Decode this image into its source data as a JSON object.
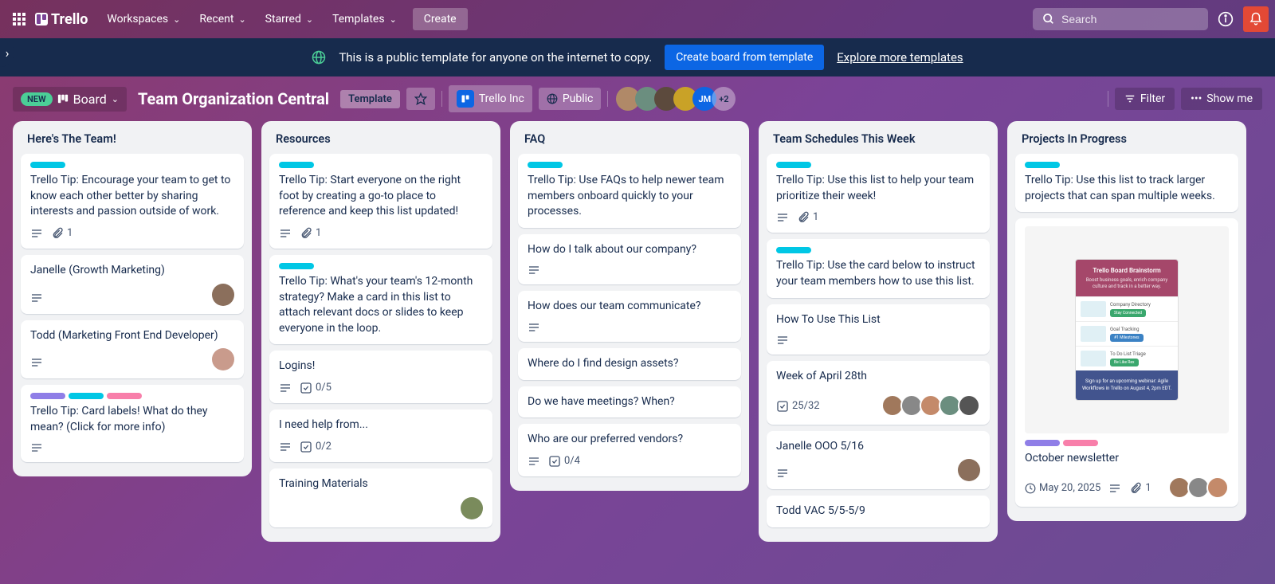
{
  "topnav": {
    "logo": "Trello",
    "menus": [
      "Workspaces",
      "Recent",
      "Starred",
      "Templates"
    ],
    "create": "Create",
    "search_placeholder": "Search"
  },
  "banner": {
    "text": "This is a public template for anyone on the internet to copy.",
    "primary_button": "Create board from template",
    "link": "Explore more templates"
  },
  "board_header": {
    "new_badge": "NEW",
    "view": "Board",
    "title": "Team Organization Central",
    "template_badge": "Template",
    "workspace": "Trello Inc",
    "visibility": "Public",
    "member_overflow": "+2",
    "filter": "Filter",
    "show_menu": "Show me"
  },
  "member_avatar": {
    "jm": "JM"
  },
  "lists": [
    {
      "title": "Here's The Team!",
      "cards": [
        {
          "labels": [
            "cyan"
          ],
          "text": "Trello Tip: Encourage your team to get to know each other better by sharing interests and passion outside of work.",
          "desc": true,
          "attach": "1"
        },
        {
          "text": "Janelle (Growth Marketing)",
          "desc": true,
          "avatar": "#8b6f5c"
        },
        {
          "text": "Todd (Marketing Front End Developer)",
          "desc": true,
          "avatar": "#c99b8c"
        },
        {
          "labels": [
            "purple",
            "cyan",
            "pink"
          ],
          "text": "Trello Tip: Card labels! What do they mean? (Click for more info)",
          "desc": true
        }
      ]
    },
    {
      "title": "Resources",
      "cards": [
        {
          "labels": [
            "cyan"
          ],
          "text": "Trello Tip: Start everyone on the right foot by creating a go-to place to reference and keep this list updated!",
          "desc": true,
          "attach": "1"
        },
        {
          "labels": [
            "cyan"
          ],
          "text": "Trello Tip: What's your team's 12-month strategy? Make a card in this list to attach relevant docs or slides to keep everyone in the loop."
        },
        {
          "text": "Logins!",
          "desc": true,
          "check": "0/5"
        },
        {
          "text": "I need help from...",
          "desc": true,
          "check": "0/2"
        },
        {
          "text": "Training Materials",
          "avatar": "#7a8b5c"
        }
      ]
    },
    {
      "title": "FAQ",
      "cards": [
        {
          "labels": [
            "cyan"
          ],
          "text": "Trello Tip: Use FAQs to help newer team members onboard quickly to your processes."
        },
        {
          "text": "How do I talk about our company?",
          "desc": true
        },
        {
          "text": "How does our team communicate?",
          "desc": true
        },
        {
          "text": "Where do I find design assets?"
        },
        {
          "text": "Do we have meetings? When?"
        },
        {
          "text": "Who are our preferred vendors?",
          "desc": true,
          "check": "0/4"
        }
      ]
    },
    {
      "title": "Team Schedules This Week",
      "cards": [
        {
          "labels": [
            "cyan"
          ],
          "text": "Trello Tip: Use this list to help your team prioritize their week!",
          "desc": true,
          "attach": "1"
        },
        {
          "labels": [
            "cyan"
          ],
          "text": "Trello Tip: Use the card below to instruct your team members how to use this list."
        },
        {
          "text": "How To Use This List",
          "desc": true
        },
        {
          "text": "Week of April 28th",
          "check": "25/32",
          "members": 5
        },
        {
          "text": "Janelle OOO 5/16",
          "desc": true,
          "avatar": "#8b6f5c"
        },
        {
          "text": "Todd VAC 5/5-5/9",
          "avatar_below": "#c99b8c"
        }
      ]
    },
    {
      "title": "Projects In Progress",
      "cards": [
        {
          "labels": [
            "cyan"
          ],
          "text": "Trello Tip: Use this list to track larger projects that can span multiple weeks."
        },
        {
          "cover": true,
          "labels": [
            "purple",
            "pink"
          ],
          "text": "October newsletter",
          "date": "May 20, 2025",
          "desc": true,
          "attach": "1",
          "members": 3
        }
      ]
    }
  ],
  "cover_mock": {
    "title": "Trello Board Brainstorm",
    "subtitle": "Boost business goals, enrich company culture and track in a better way.",
    "rows": [
      {
        "label": "Company Directory",
        "pill": "Stay Connected",
        "pill_color": "#3aa76d"
      },
      {
        "label": "Goal Tracking",
        "pill": "#1 Milestones",
        "pill_color": "#3b82c4"
      },
      {
        "label": "To Do List Triage",
        "pill": "Be Like Rex",
        "pill_color": "#3aa76d"
      }
    ],
    "footer": "Sign up for an upcoming webinar: Agile Workflows in Trello on August 4, 2pm EDT."
  }
}
